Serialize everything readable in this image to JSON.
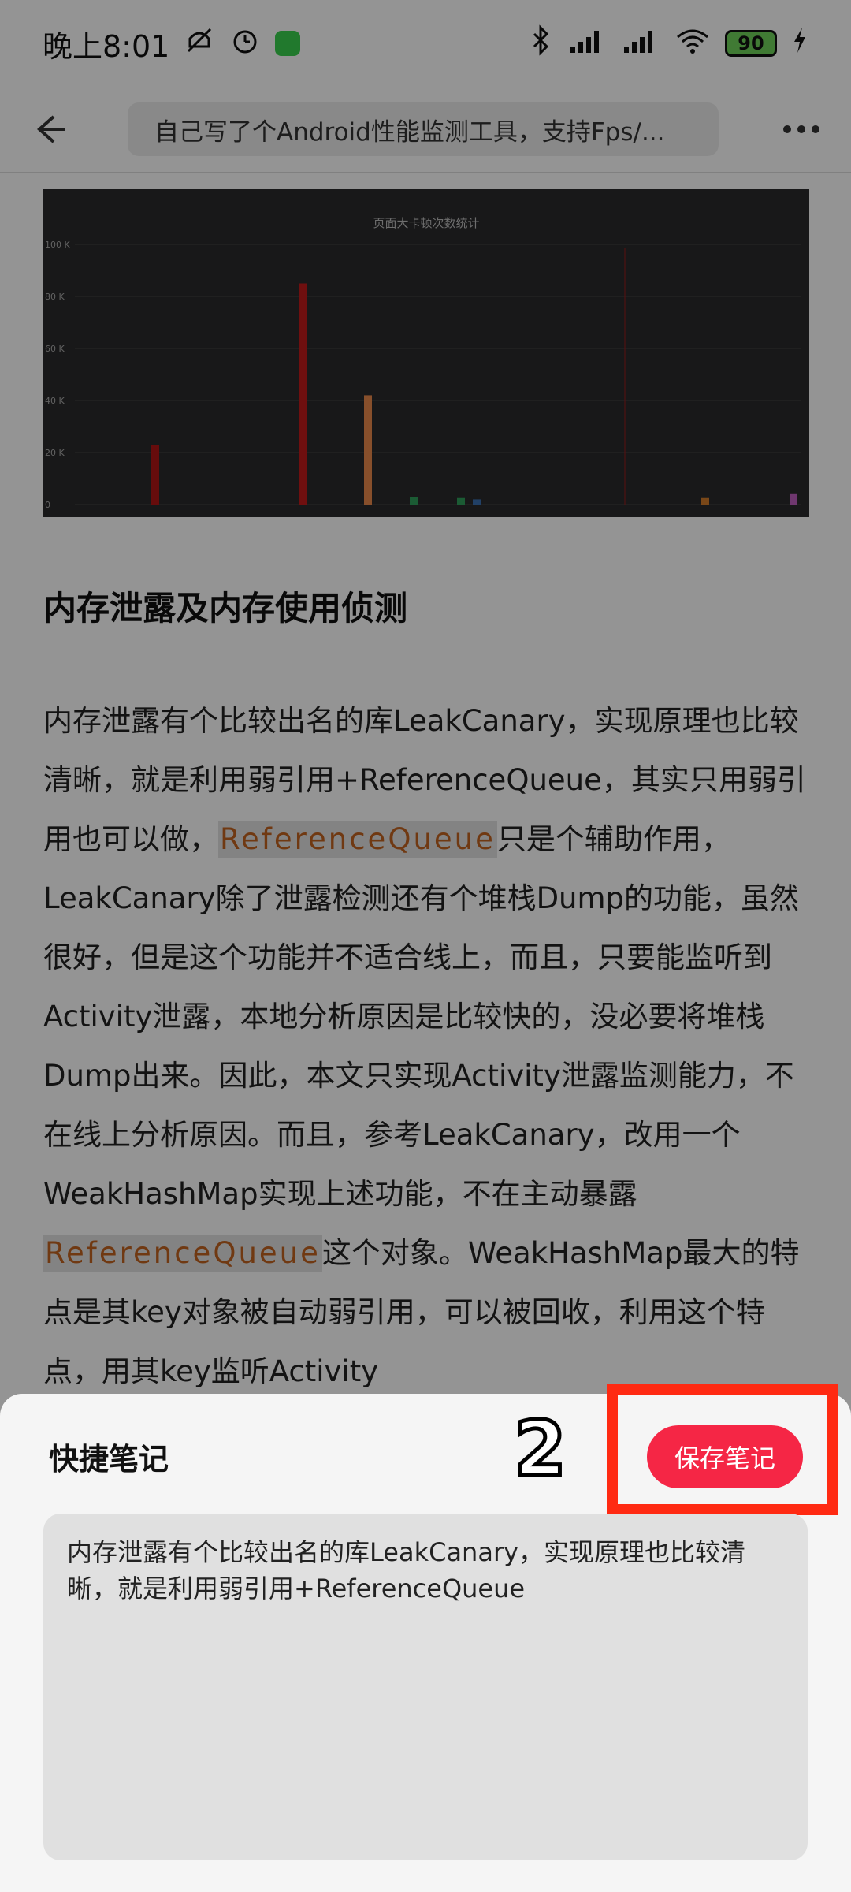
{
  "status_bar": {
    "time": "晚上8:01",
    "battery": "90",
    "icons": [
      "mute-icon",
      "alarm-icon",
      "app-notification-icon",
      "bluetooth-icon",
      "hd-signal-icon",
      "hd-signal-icon",
      "wifi-icon",
      "charging-icon"
    ]
  },
  "top_bar": {
    "url_title": "自己写了个Android性能监测工具，支持Fps/..."
  },
  "chart": {
    "chart_data": {
      "type": "bar",
      "title": "页面大卡顿次数统计",
      "ylim": [
        0,
        100000
      ],
      "yticks": [
        "100 K",
        "80 K",
        "60 K",
        "40 K",
        "20 K",
        "0"
      ],
      "grid": true,
      "series_values": [
        23000,
        85000,
        42000,
        3000,
        2500,
        2000,
        2500,
        4000
      ]
    }
  },
  "article": {
    "heading": "内存泄露及内存使用侦测",
    "p_part1": "内存泄露有个比较出名的库LeakCanary，实现原理也比较清晰，就是利用弱引用+ReferenceQueue，其实只用弱引用也可以做，",
    "p_code1": "ReferenceQueue",
    "p_part2": "只是个辅助作用，LeakCanary除了泄露检测还有个堆栈Dump的功能，虽然很好，但是这个功能并不适合线上，而且，只要能监听到Activity泄露，本地分析原因是比较快的，没必要将堆栈Dump出来。因此，本文只实现Activity泄露监测能力，不在线上分析原因。而且，参考LeakCanary，改用一个WeakHashMap实现上述功能，不在主动暴露",
    "p_code2": "ReferenceQueue",
    "p_part3": "这个对象。WeakHashMap最大的特点是其key对象被自动弱引用，可以被回收，利用这个特点，用其key监听Activity"
  },
  "note_sheet": {
    "title": "快捷笔记",
    "step_number": "2",
    "save_label": "保存笔记",
    "note_text": "内存泄露有个比较出名的库LeakCanary，实现原理也比较清晰，就是利用弱引用+ReferenceQueue",
    "highlight_color": "#ff2a12",
    "accent_color": "#f52645"
  }
}
